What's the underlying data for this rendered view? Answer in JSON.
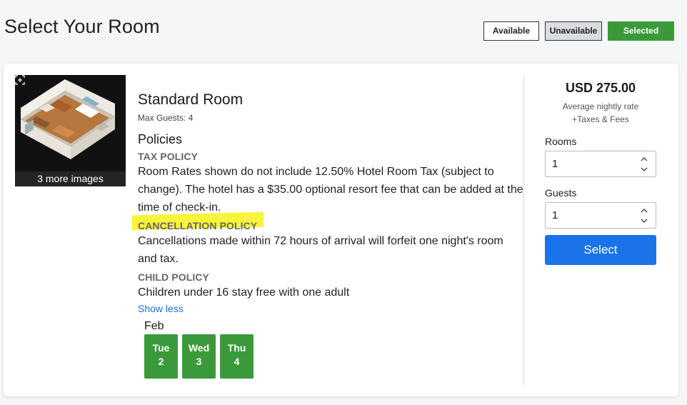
{
  "page": {
    "title": "Select Your Room"
  },
  "legend": {
    "available": "Available",
    "unavailable": "Unavailable",
    "selected": "Selected"
  },
  "room": {
    "image_overlay": "3 more images",
    "name": "Standard Room",
    "max_guests": "Max Guests: 4",
    "policies_heading": "Policies",
    "policies": [
      {
        "label": "TAX POLICY",
        "text": "Room Rates shown do not include 12.50% Hotel Room Tax (subject to change). The hotel has a $35.00 optional resort fee that can be added at the time of check-in."
      },
      {
        "label": "CANCELLATION POLICY",
        "text": "Cancellations made within 72 hours of arrival will forfeit one night's room and tax."
      },
      {
        "label": "CHILD POLICY",
        "text": "Children under 16 stay free with one adult"
      }
    ],
    "show_less": "Show less",
    "month": "Feb",
    "dates": [
      {
        "day": "Tue",
        "num": "2"
      },
      {
        "day": "Wed",
        "num": "3"
      },
      {
        "day": "Thu",
        "num": "4"
      }
    ]
  },
  "booking": {
    "price": "USD 275.00",
    "rate_note_1": "Average nightly rate",
    "rate_note_2": "+Taxes & Fees",
    "rooms_label": "Rooms",
    "rooms_value": "1",
    "guests_label": "Guests",
    "guests_value": "1",
    "select_label": "Select"
  },
  "colors": {
    "selected_green": "#3a9a3a",
    "primary_blue": "#1a73e8",
    "highlight_yellow": "#f8f43a"
  },
  "icons": {
    "expand": "expand-icon",
    "stepper": "stepper-icon"
  }
}
